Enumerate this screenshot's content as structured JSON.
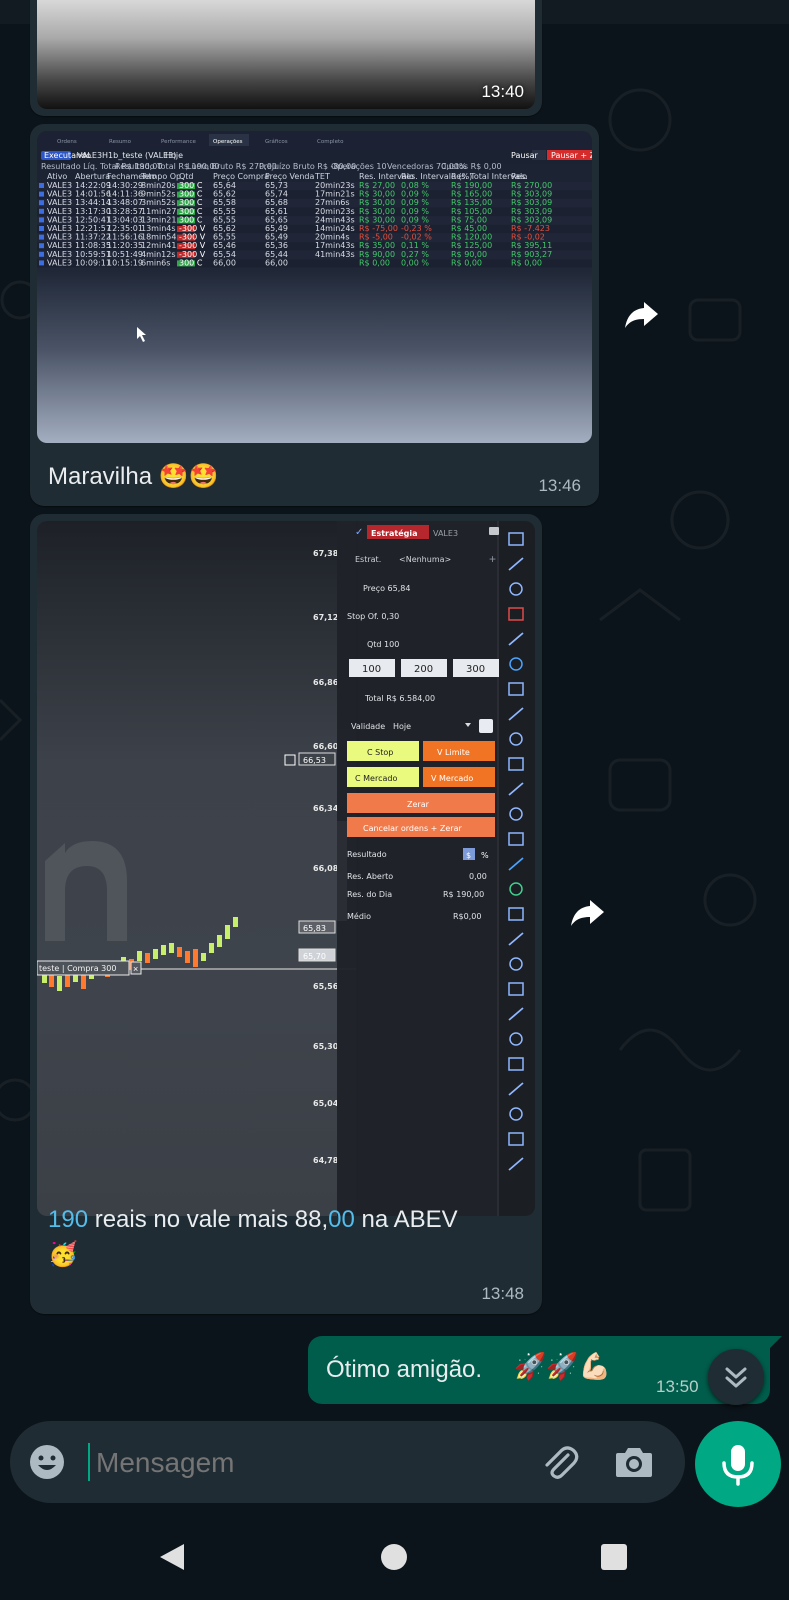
{
  "messages": [
    {
      "time": "13:40"
    },
    {
      "time": "13:46",
      "caption": "Maravilha",
      "emoji": "🤩🤩"
    },
    {
      "time": "13:48",
      "caption_parts": [
        "190",
        " reais no vale mais 88,",
        "00",
        " na ABEV"
      ],
      "emoji": "🥳"
    }
  ],
  "outgoing": {
    "text": "Ótimo amigão.",
    "emoji": "🚀🚀💪🏻",
    "time": "13:50"
  },
  "input": {
    "placeholder": "Mensagem"
  },
  "icons": [
    "emoji-icon",
    "attach-icon",
    "camera-icon",
    "mic-icon",
    "forward-icon",
    "scroll-down-icon",
    "back-icon",
    "home-icon",
    "recents-icon"
  ],
  "platform": {
    "tabs": [
      "Ordens",
      "Resumo",
      "Performance",
      "Operações",
      "Gráficos",
      "Completo"
    ],
    "filter_chip": "Executando",
    "account": "VALE3H1b_teste (VALE3)",
    "period": "Hoje",
    "btn_pause": "Pausar",
    "btn_stop": "Pausar + Zerar",
    "summary": [
      "Resultado Líq. Total R$ 190,00",
      "Resultado Total R$ 190,00",
      "Lucro Bruto R$ 270,00",
      "Prejuízo Bruto R$ -80,00",
      "Operações 10",
      "Vencedoras 70,00%",
      "Custos R$ 0,00"
    ],
    "headers": [
      "Ativo",
      "Abertura",
      "Fechamento",
      "Tempo Op.",
      "Qtd",
      "Preço Compra",
      "Preço Venda",
      "TET",
      "Res. Intervalo",
      "Res. Intervalo (%)",
      "Res. Total Intervalo",
      "Res."
    ],
    "rows": [
      [
        "VALE3",
        "14:22:09",
        "14:30:29",
        "8min20s",
        "300 C",
        "65,64",
        "65,73",
        "20min23s",
        "R$ 27,00",
        "0,08 %",
        "R$ 190,00",
        "R$ 270,00"
      ],
      [
        "VALE3",
        "14:01:56",
        "14:11:36",
        "9min52s",
        "300 C",
        "65,62",
        "65,74",
        "17min21s",
        "R$ 30,00",
        "0,09 %",
        "R$ 165,00",
        "R$ 303,09"
      ],
      [
        "VALE3",
        "13:44:14",
        "13:48:07",
        "3min52s",
        "300 C",
        "65,58",
        "65,68",
        "27min6s",
        "R$ 30,00",
        "0,09 %",
        "R$ 135,00",
        "R$ 303,09"
      ],
      [
        "VALE3",
        "13:17:30",
        "13:28:57",
        "11min27s",
        "300 C",
        "65,55",
        "65,61",
        "20min23s",
        "R$ 30,00",
        "0,09 %",
        "R$ 105,00",
        "R$ 303,09"
      ],
      [
        "VALE3",
        "12:50:41",
        "13:04:03",
        "13min21s",
        "300 C",
        "65,55",
        "65,65",
        "24min43s",
        "R$ 30,00",
        "0,09 %",
        "R$ 75,00",
        "R$ 303,09"
      ],
      [
        "VALE3",
        "12:21:57",
        "12:35:01",
        "13min4s",
        "-300 V",
        "65,62",
        "65,49",
        "14min24s",
        "R$ -75,00",
        "-0,23 %",
        "R$ 45,00",
        "R$ -7.423"
      ],
      [
        "VALE3",
        "11:37:22",
        "11:56:16",
        "18min54s",
        "-300 V",
        "65,55",
        "65,49",
        "20min4s",
        "R$ -5,00",
        "-0,02 %",
        "R$ 120,00",
        "R$ -0,02"
      ],
      [
        "VALE3",
        "11:08:35",
        "11:20:35",
        "12min41s",
        "-300 V",
        "65,46",
        "65,36",
        "17min43s",
        "R$ 35,00",
        "0,11 %",
        "R$ 125,00",
        "R$ 395,11"
      ],
      [
        "VALE3",
        "10:59:51",
        "10:51:49",
        "4min12s",
        "-300 V",
        "65,54",
        "65,44",
        "41min43s",
        "R$ 90,00",
        "0,27 %",
        "R$ 90,00",
        "R$ 903,27"
      ],
      [
        "VALE3",
        "10:09:11",
        "10:15:19",
        "6min6s",
        "300 C",
        "66,00",
        "66,00",
        "",
        "R$ 0,00",
        "0,00 %",
        "R$ 0,00",
        "R$ 0,00"
      ]
    ]
  },
  "chart": {
    "price_levels": [
      "67,38",
      "67,12",
      "66,86",
      "66,60",
      "66,34",
      "66,08",
      "65,56",
      "65,30",
      "65,04",
      "64,78"
    ],
    "current_tag": "66,53",
    "tag_1": "65,83",
    "tag_2": "65,70",
    "position_label": "teste | Compra 300",
    "order_panel": {
      "title": "Estratégia",
      "ticker": "VALE3",
      "strategy_label": "Estrat.",
      "strategy_value": "<Nenhuma>",
      "price": "Preço 65,84",
      "stop_offset": "Stop Of. 0,30",
      "qty": "Qtd 100",
      "qty_buttons": [
        "100",
        "200",
        "300"
      ],
      "total": "Total R$ 6.584,00",
      "validity_label": "Validade",
      "validity_value": "Hoje",
      "btn_c_stop": "C Stop",
      "btn_v_limite": "V Limite",
      "btn_c_mercado": "C Mercado",
      "btn_v_mercado": "V Mercado",
      "btn_zerar": "Zerar",
      "btn_cancelar": "Cancelar ordens + Zerar",
      "result_label": "Resultado",
      "result_currency": "$",
      "result_percent": "%",
      "res_open_label": "Res. Aberto",
      "res_open_value": "0,00",
      "res_day_label": "Res. do Dia",
      "res_day_value": "R$ 190,00",
      "avg_label": "Médio",
      "avg_value": "R$0,00"
    }
  }
}
